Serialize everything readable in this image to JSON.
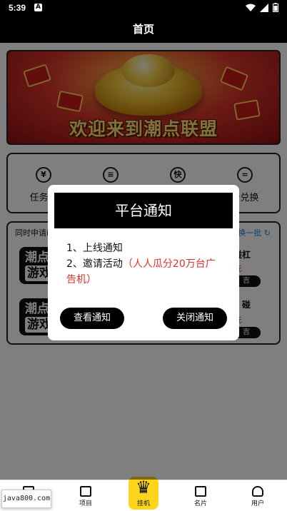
{
  "status_bar": {
    "time": "5:39",
    "badge": "A"
  },
  "header": {
    "title": "首页"
  },
  "banner": {
    "slogan": "欢迎来到潮点联盟"
  },
  "quick_menu": [
    {
      "icon": "yuan-icon",
      "glyph": "¥",
      "label": "任务大"
    },
    {
      "icon": "list-icon",
      "glyph": "≡",
      "label": ""
    },
    {
      "icon": "fast-icon",
      "glyph": "快",
      "label": ""
    },
    {
      "icon": "exchange-icon",
      "glyph": "=",
      "label": "分兑换"
    }
  ],
  "game_list": {
    "header": "同时申请i",
    "refresh_label": "换一批",
    "items": [
      {
        "logo_line1": "潮点",
        "logo_line2": "游戏",
        "name": "碰杠",
        "sub": "元",
        "action": "吉"
      },
      {
        "logo_line1": "潮点",
        "logo_line2": "游戏",
        "name": "碰",
        "sub": "元",
        "action": "吉"
      }
    ]
  },
  "dialog": {
    "title": "平台通知",
    "line1": "1、上线通知",
    "line2_prefix": "2、邀请活动",
    "line2_highlight": "（人人瓜分20万台广告机）",
    "view_button": "查看通知",
    "close_button": "关闭通知"
  },
  "bottom_nav": {
    "items": [
      {
        "icon": "home-icon",
        "label": ""
      },
      {
        "icon": "project-icon",
        "label": "项目"
      },
      {
        "icon": "crown-icon",
        "label": "挂机"
      },
      {
        "icon": "card-icon",
        "label": "名片"
      },
      {
        "icon": "user-icon",
        "label": "用户"
      }
    ]
  },
  "watermark": "java800.com",
  "colors": {
    "accent_yellow": "#ffd51c",
    "highlight_red": "#e0312b",
    "header_black": "#000000"
  }
}
